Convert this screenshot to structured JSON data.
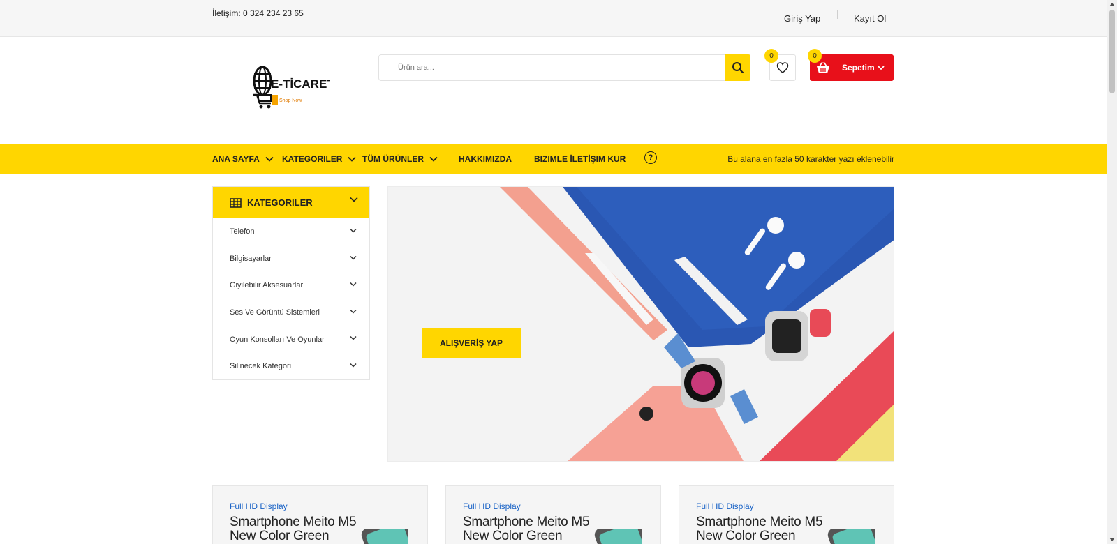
{
  "topbar": {
    "contact": "İletişim: 0 324 234 23 65",
    "login": "Giriş Yap",
    "register": "Kayıt Ol"
  },
  "logo": {
    "main": "E-TİCARET",
    "sub": "Shop Now"
  },
  "search": {
    "placeholder": "Ürün ara..."
  },
  "wishlist": {
    "count": "0"
  },
  "cart": {
    "count": "0",
    "label": "Sepetim"
  },
  "nav": {
    "items": [
      {
        "label": "ANA SAYFA"
      },
      {
        "label": "KATEGORILER"
      },
      {
        "label": "TÜM ÜRÜNLER"
      },
      {
        "label": "HAKKIMIZDA"
      },
      {
        "label": "BIZIMLE İLETİŞIM KUR"
      }
    ],
    "help": "?",
    "note": "Bu alana en fazla 50 karakter yazı eklenebilir"
  },
  "categories": {
    "title": "KATEGORILER",
    "items": [
      "Telefon",
      "Bilgisayarlar",
      "Giyilebilir Aksesuarlar",
      "Ses Ve Görüntü Sistemleri",
      "Oyun Konsolları Ve Oyunlar",
      "Silinecek Kategori"
    ]
  },
  "banner": {
    "cta": "ALIŞVERİŞ YAP"
  },
  "products": [
    {
      "tag": "Full HD Display",
      "name": "Smartphone Meito M5 New Color Green"
    },
    {
      "tag": "Full HD Display",
      "name": "Smartphone Meito M5 New Color Green"
    },
    {
      "tag": "Full HD Display",
      "name": "Smartphone Meito M5 New Color Green"
    }
  ],
  "colors": {
    "accent": "#ffd600",
    "cart": "#e8101a",
    "link": "#1a63c6"
  }
}
